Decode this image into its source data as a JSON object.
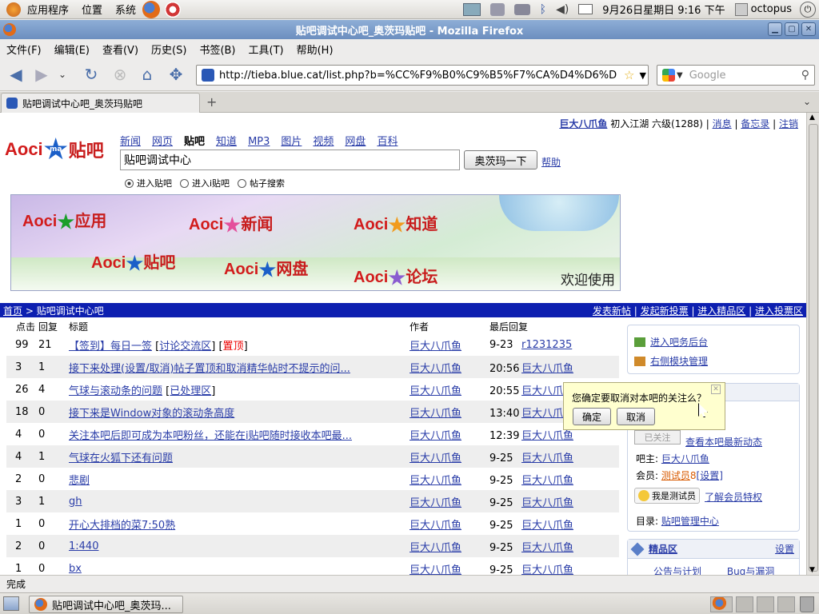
{
  "desktop": {
    "menus": [
      "应用程序",
      "位置",
      "系统"
    ],
    "clock": "9月26日星期日  9:16 下午",
    "user": "octopus"
  },
  "window": {
    "title": "贴吧调试中心吧_奥茨玛贴吧 - Mozilla Firefox"
  },
  "menubar": [
    "文件(F)",
    "编辑(E)",
    "查看(V)",
    "历史(S)",
    "书签(B)",
    "工具(T)",
    "帮助(H)"
  ],
  "toolbar": {
    "url": "http://tieba.blue.cat/list.php?b=%CC%F9%B0%C9%B5%F7%CA%D4%D6%D",
    "search_placeholder": "Google"
  },
  "tab": {
    "label": "贴吧调试中心吧_奥茨玛贴吧"
  },
  "page": {
    "userbar": {
      "username": "巨大八爪鱼",
      "rank": "初入江湖 六级(1288) |",
      "links": [
        "消息",
        "备忘录",
        "注销"
      ]
    },
    "logo": {
      "text": "Aoci",
      "badge": "ma",
      "suffix": "贴吧"
    },
    "nav": [
      "新闻",
      "网页",
      "贴吧",
      "知道",
      "MP3",
      "图片",
      "视频",
      "网盘",
      "百科"
    ],
    "search": {
      "value": "贴吧调试中心",
      "button": "奥茨玛一下",
      "help": "帮助"
    },
    "radios": [
      "进入贴吧",
      "进入i贴吧",
      "帖子搜索"
    ],
    "banner": {
      "items": [
        "应用",
        "新闻",
        "知道",
        "贴吧",
        "网盘",
        "论坛"
      ],
      "brand": "Aoci",
      "badge": "ma",
      "welcome": "欢迎使用"
    },
    "crumb": {
      "home": "首页",
      "sep": " > ",
      "current": "贴吧调试中心吧",
      "actions": [
        "发表新帖",
        "发起新投票",
        "进入精品区",
        "进入投票区"
      ]
    },
    "table": {
      "headers": [
        "点击",
        "回复",
        "标题",
        "作者",
        "最后回复"
      ],
      "rows": [
        {
          "clicks": "99",
          "replies": "21",
          "title": "【签到】每日一签",
          "tag": "讨论交流区",
          "top": "置顶",
          "author": "巨大八爪鱼",
          "time": "9-23",
          "last": "r1231235"
        },
        {
          "clicks": "3",
          "replies": "1",
          "title": "接下来处理(设置/取消)帖子置顶和取消精华帖时不提示的问...",
          "tag": "",
          "top": "",
          "author": "巨大八爪鱼",
          "time": "20:56",
          "last": "巨大八爪鱼"
        },
        {
          "clicks": "26",
          "replies": "4",
          "title": "气球与滚动条的问题",
          "tag": "已处理区",
          "top": "",
          "author": "巨大八爪鱼",
          "time": "20:55",
          "last": "巨大八爪鱼"
        },
        {
          "clicks": "18",
          "replies": "0",
          "title": "接下来是Window对象的滚动条高度",
          "tag": "",
          "top": "",
          "author": "巨大八爪鱼",
          "time": "13:40",
          "last": "巨大八爪鱼"
        },
        {
          "clicks": "4",
          "replies": "0",
          "title": "关注本吧后即可成为本吧粉丝，还能在i贴吧随时接收本吧最...",
          "tag": "",
          "top": "",
          "author": "巨大八爪鱼",
          "time": "12:39",
          "last": "巨大八爪鱼"
        },
        {
          "clicks": "4",
          "replies": "1",
          "title": "气球在火狐下还有问题",
          "tag": "",
          "top": "",
          "author": "巨大八爪鱼",
          "time": "9-25",
          "last": "巨大八爪鱼"
        },
        {
          "clicks": "2",
          "replies": "0",
          "title": "悲剧",
          "tag": "",
          "top": "",
          "author": "巨大八爪鱼",
          "time": "9-25",
          "last": "巨大八爪鱼"
        },
        {
          "clicks": "3",
          "replies": "1",
          "title": "gh",
          "tag": "",
          "top": "",
          "author": "巨大八爪鱼",
          "time": "9-25",
          "last": "巨大八爪鱼"
        },
        {
          "clicks": "1",
          "replies": "0",
          "title": "开心大排档的菜7:50熟",
          "tag": "",
          "top": "",
          "author": "巨大八爪鱼",
          "time": "9-25",
          "last": "巨大八爪鱼"
        },
        {
          "clicks": "2",
          "replies": "0",
          "title": "1:440",
          "tag": "",
          "top": "",
          "author": "巨大八爪鱼",
          "time": "9-25",
          "last": "巨大八爪鱼"
        },
        {
          "clicks": "1",
          "replies": "0",
          "title": "bx",
          "tag": "",
          "top": "",
          "author": "巨大八爪鱼",
          "time": "9-25",
          "last": "巨大八爪鱼"
        }
      ]
    },
    "sidebar": {
      "admin_links": [
        "进入吧务后台",
        "右侧模块管理"
      ],
      "followed": "已关注",
      "latest": "查看本吧最新动态",
      "owner_label": "吧主:",
      "owner": "巨大八爪鱼",
      "member_label": "会员:",
      "member": "测试员",
      "member_count": "8",
      "member_settings": "[设置]",
      "badge": "我是测试员",
      "member_rights": "了解会员特权",
      "dir_label": "目录:",
      "dir": "贴吧管理中心",
      "featured": "精品区",
      "featured_settings": "设置",
      "featured_items": [
        "公告与计划",
        "Bug与漏洞"
      ]
    },
    "tooltip": {
      "question": "您确定要取消对本吧的关注么？",
      "ok": "确定",
      "cancel": "取消"
    }
  },
  "statusbar": {
    "text": "完成"
  },
  "taskbar": {
    "task": "贴吧调试中心吧_奥茨玛..."
  }
}
